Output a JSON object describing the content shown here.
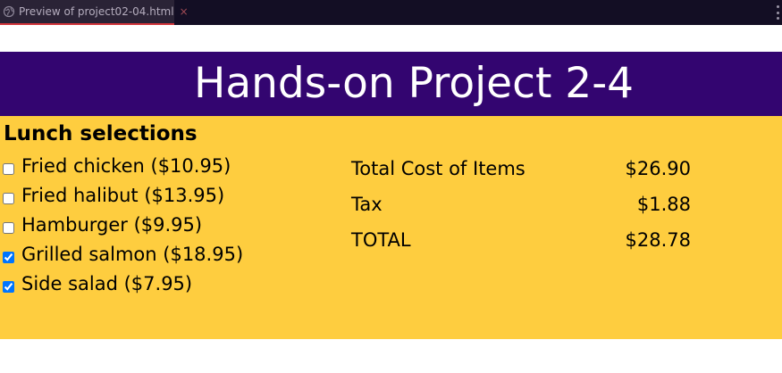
{
  "browser": {
    "tab_title": "Preview of project02-04.html",
    "tab_close": "×"
  },
  "page": {
    "title": "Hands-on Project 2-4",
    "lunch_heading": "Lunch selections",
    "items": [
      {
        "label": "Fried chicken ($10.95)",
        "checked": false
      },
      {
        "label": "Fried halibut ($13.95)",
        "checked": false
      },
      {
        "label": "Hamburger ($9.95)",
        "checked": false
      },
      {
        "label": "Grilled salmon ($18.95)",
        "checked": true
      },
      {
        "label": "Side salad ($7.95)",
        "checked": true
      }
    ],
    "totals": {
      "items_label": "Total Cost of Items",
      "items_value": "$26.90",
      "tax_label": "Tax",
      "tax_value": "$1.88",
      "total_label": "TOTAL",
      "total_value": "$28.78"
    }
  },
  "colors": {
    "banner_bg": "#330570",
    "content_bg": "#fecd3f",
    "tab_accent": "#d0343a"
  }
}
